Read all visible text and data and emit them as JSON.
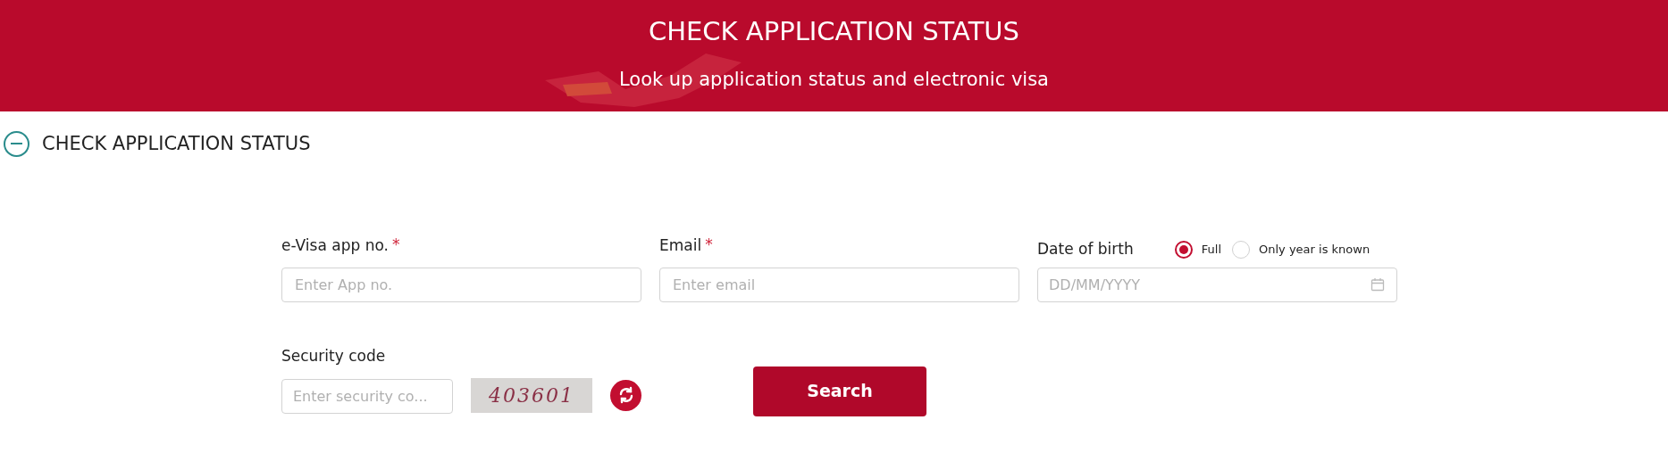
{
  "header": {
    "title": "CHECK APPLICATION STATUS",
    "subtitle": "Look up application status and electronic visa"
  },
  "section": {
    "title": "CHECK APPLICATION STATUS",
    "expanded": true
  },
  "fields": [
    {
      "label": "e-Visa app no.",
      "required_mark": "*",
      "placeholder": "Enter App no."
    },
    {
      "label": "Email",
      "required_mark": "*",
      "placeholder": "Enter email"
    }
  ],
  "date_of_birth": {
    "label": "Date of birth",
    "placeholder": "DD/MM/YYYY",
    "options": [
      {
        "label": "Full",
        "selected": true
      },
      {
        "label": "Only year is known",
        "selected": false
      }
    ]
  },
  "security": {
    "label": "Security code",
    "placeholder": "Enter security co...",
    "captcha": "403601"
  },
  "search_button": "Search"
}
